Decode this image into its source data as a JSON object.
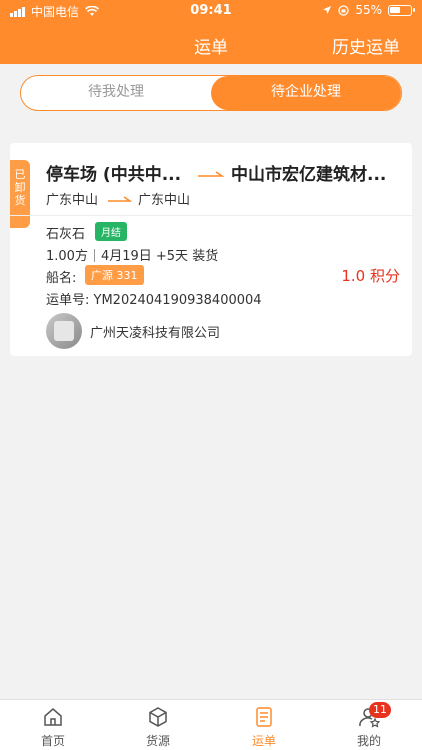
{
  "status": {
    "carrier": "中国电信",
    "time": "09:41",
    "battery": "55%",
    "battery_level": 0.55
  },
  "nav": {
    "title": "运单",
    "history": "历史运单"
  },
  "segments": {
    "left": "待我处理",
    "right": "待企业处理"
  },
  "card": {
    "status_tag": "已卸货",
    "from_main": "停车场 (中共中...",
    "to_main": "中山市宏亿建筑材...",
    "from_sub": "广东中山",
    "to_sub": "广东中山",
    "cargo": "石灰石",
    "settle_badge": "月结",
    "quantity": "1.00方",
    "schedule": "4月19日 +5天 装货",
    "ship_label": "船名:",
    "ship_name": "广源 331",
    "points": "1.0 积分",
    "order_no": "运单号: YM202404190938400004",
    "company": "广州天凌科技有限公司"
  },
  "tabbar": {
    "items": [
      {
        "label": "首页",
        "icon": "home-icon"
      },
      {
        "label": "货源",
        "icon": "box-icon"
      },
      {
        "label": "运单",
        "icon": "waybill-icon"
      },
      {
        "label": "我的",
        "icon": "profile-icon"
      }
    ],
    "badge": "11"
  },
  "colors": {
    "brand": "#ff8b2c",
    "green": "#27b565",
    "red": "#e8321d"
  }
}
